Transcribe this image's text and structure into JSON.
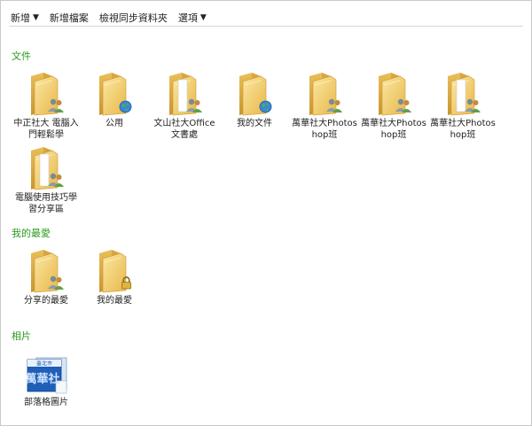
{
  "toolbar": {
    "new_label": "新增",
    "new_file_label": "新增檔案",
    "view_sync_label": "檢視同步資料夾",
    "options_label": "選項",
    "caret": "▼"
  },
  "sections": {
    "documents": {
      "title": "文件",
      "items": [
        {
          "label": "中正社大 電腦入門輕鬆學",
          "icon": "shared-folder-icon"
        },
        {
          "label": "公用",
          "icon": "public-folder-icon"
        },
        {
          "label": "文山社大Office文書處",
          "icon": "shared-folder-icon"
        },
        {
          "label": "我的文件",
          "icon": "public-folder-icon"
        },
        {
          "label": "萬華社大Photoshop班",
          "icon": "shared-folder-icon"
        },
        {
          "label": "萬華社大Photoshop班",
          "icon": "shared-folder-icon"
        },
        {
          "label": "萬華社大Photoshop班",
          "icon": "shared-folder-icon"
        },
        {
          "label": "電腦使用技巧學習分享區",
          "icon": "shared-folder-icon"
        }
      ]
    },
    "favorites": {
      "title": "我的最愛",
      "items": [
        {
          "label": "分享的最愛",
          "icon": "shared-folder-icon"
        },
        {
          "label": "我的最愛",
          "icon": "locked-folder-icon"
        }
      ]
    },
    "photos": {
      "title": "相片",
      "items": [
        {
          "label": "部落格圖片",
          "icon": "photo-album-icon",
          "thumb_text_top": "臺北市",
          "thumb_text_main": "萬華社"
        }
      ]
    }
  },
  "colors": {
    "section_title": "#2a9a1a",
    "folder_body": "#f2cf6a",
    "folder_dark": "#d9a93a",
    "folder_light": "#fbe7a3",
    "photo_blue": "#1f5fb8"
  }
}
